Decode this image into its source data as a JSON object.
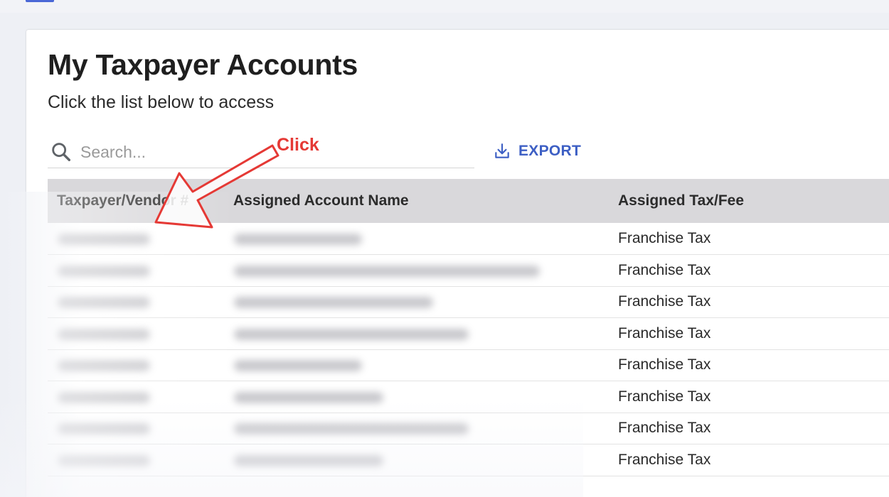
{
  "page": {
    "title": "My Taxpayer Accounts",
    "subtitle": "Click the list below to access"
  },
  "search": {
    "placeholder": "Search...",
    "icon": "search-icon"
  },
  "toolbar": {
    "export_label": "EXPORT",
    "export_icon": "download-icon",
    "accent_color": "#3d5fc4"
  },
  "table": {
    "columns": [
      {
        "label": "Taxpayer/Vendor #"
      },
      {
        "label": "Assigned Account Name"
      },
      {
        "label": "Assigned Tax/Fee"
      }
    ],
    "rows": [
      {
        "taxpayer_id": "",
        "account_name": "",
        "tax_fee": "Franchise Tax"
      },
      {
        "taxpayer_id": "",
        "account_name": "",
        "tax_fee": "Franchise Tax"
      },
      {
        "taxpayer_id": "",
        "account_name": "",
        "tax_fee": "Franchise Tax"
      },
      {
        "taxpayer_id": "",
        "account_name": "",
        "tax_fee": "Franchise Tax"
      },
      {
        "taxpayer_id": "",
        "account_name": "",
        "tax_fee": "Franchise Tax"
      },
      {
        "taxpayer_id": "",
        "account_name": "",
        "tax_fee": "Franchise Tax"
      },
      {
        "taxpayer_id": "",
        "account_name": "",
        "tax_fee": "Franchise Tax"
      },
      {
        "taxpayer_id": "",
        "account_name": "",
        "tax_fee": "Franchise Tax"
      }
    ]
  },
  "annotation": {
    "label": "Click",
    "color": "#e53935"
  }
}
